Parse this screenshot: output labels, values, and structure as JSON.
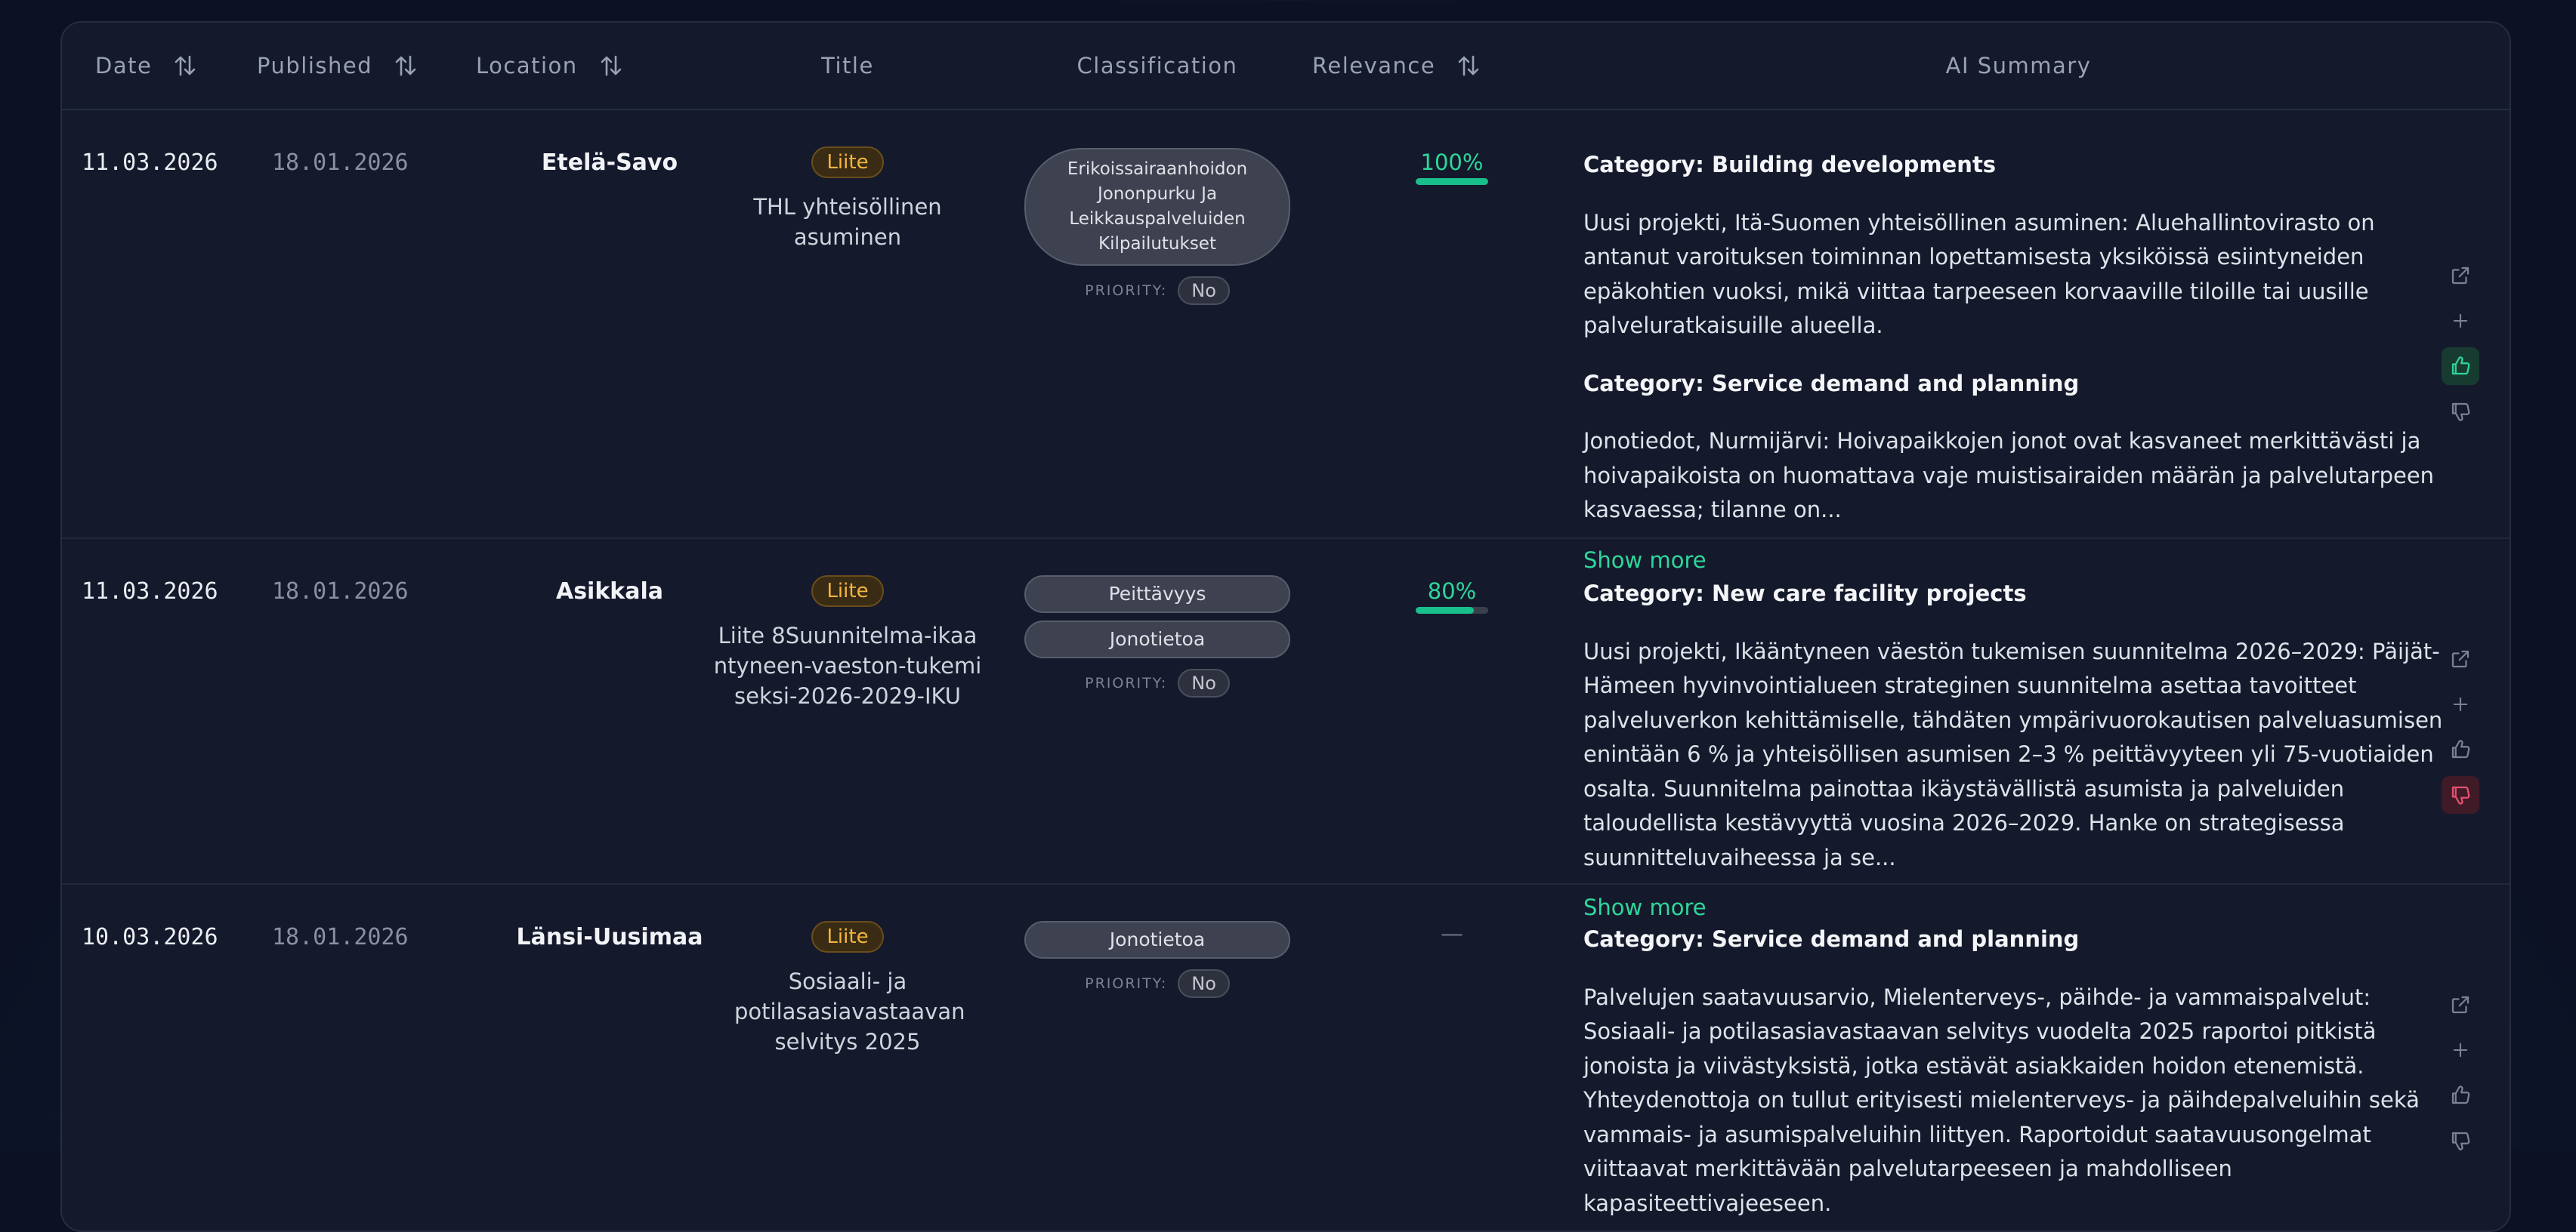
{
  "columns": {
    "date": "Date",
    "published": "Published",
    "location": "Location",
    "title": "Title",
    "classification": "Classification",
    "relevance": "Relevance",
    "summary": "AI Summary"
  },
  "priority_label": "PRIORITY:",
  "show_more": "Show more",
  "icons": {
    "sort": "sort-arrows-icon",
    "open": "external-link-icon",
    "add": "plus-icon",
    "up": "thumbs-up-icon",
    "down": "thumbs-down-icon"
  },
  "colors": {
    "accent_green": "#2fd69a",
    "badge_amber": "#f2b640",
    "dislike_red": "#e8506d"
  },
  "rows": [
    {
      "date": "11.03.2026",
      "published": "18.01.2026",
      "location": "Etelä-Savo",
      "badge": "Liite",
      "title": "THL yhteisöllinen asuminen",
      "classification": [
        "Erikoissairaanhoidon Jononpurku Ja Leikkauspalveluiden Kilpailutukset"
      ],
      "priority": "No",
      "relevance": "100%",
      "relevance_value": 1.0,
      "summary": [
        {
          "category": "Category: Building developments",
          "text": "Uusi projekti, Itä-Suomen yhteisöllinen asuminen: Aluehallintovirasto on antanut varoituksen toiminnan lopettamisesta yksiköissä esiintyneiden epäkohtien vuoksi, mikä viittaa tarpeeseen korvaaville tiloille tai uusille palveluratkaisuille alueella."
        },
        {
          "category": "Category: Service demand and planning",
          "text": "Jonotiedot, Nurmijärvi: Hoivapaikkojen jonot ovat kasvaneet merkittävästi ja hoivapaikoista on huomattava vaje muistisairaiden määrän ja palvelutarpeen kasvaessa; tilanne on..."
        }
      ],
      "feedback": "up"
    },
    {
      "date": "11.03.2026",
      "published": "18.01.2026",
      "location": "Asikkala",
      "badge": "Liite",
      "title": "Liite 8Suunnitelma-ikaantyneen-vaeston-tukemiseksi-2026-2029-IKU",
      "classification": [
        "Peittävyys",
        "Jonotietoa"
      ],
      "priority": "No",
      "relevance": "80%",
      "relevance_value": 0.8,
      "summary": [
        {
          "category": "Category: New care facility projects",
          "text": "Uusi projekti, Ikääntyneen väestön tukemisen suunnitelma 2026–2029: Päijät-Hämeen hyvinvointialueen strateginen suunnitelma asettaa tavoitteet palveluverkon kehittämiselle, tähdäten ympärivuorokautisen palveluasumisen enintään 6 % ja yhteisöllisen asumisen 2–3 % peittävyyteen yli 75-vuotiaiden osalta. Suunnitelma painottaa ikäystävällistä asumista ja palveluiden taloudellista kestävyyttä vuosina 2026–2029. Hanke on strategisessa suunnitteluvaiheessa ja se..."
        }
      ],
      "feedback": "down"
    },
    {
      "date": "10.03.2026",
      "published": "18.01.2026",
      "location": "Länsi-Uusimaa",
      "badge": "Liite",
      "title": "Sosiaali- ja potilasasiavastaavan selvitys 2025",
      "classification": [
        "Jonotietoa"
      ],
      "priority": "No",
      "relevance": "—",
      "relevance_value": null,
      "summary": [
        {
          "category": "Category: Service demand and planning",
          "text": "Palvelujen saatavuusarvio, Mielenterveys-, päihde- ja vammaispalvelut: Sosiaali- ja potilasasiavastaavan selvitys vuodelta 2025 raportoi pitkistä jonoista ja viivästyksistä, jotka estävät asiakkaiden hoidon etenemistä. Yhteydenottoja on tullut erityisesti mielenterveys- ja päihdepalveluihin sekä vammais- ja asumispalveluihin liittyen. Raportoidut saatavuusongelmat viittaavat merkittävään palvelutarpeeseen ja mahdolliseen kapasiteettivajeeseen."
        }
      ],
      "feedback": "none"
    }
  ]
}
